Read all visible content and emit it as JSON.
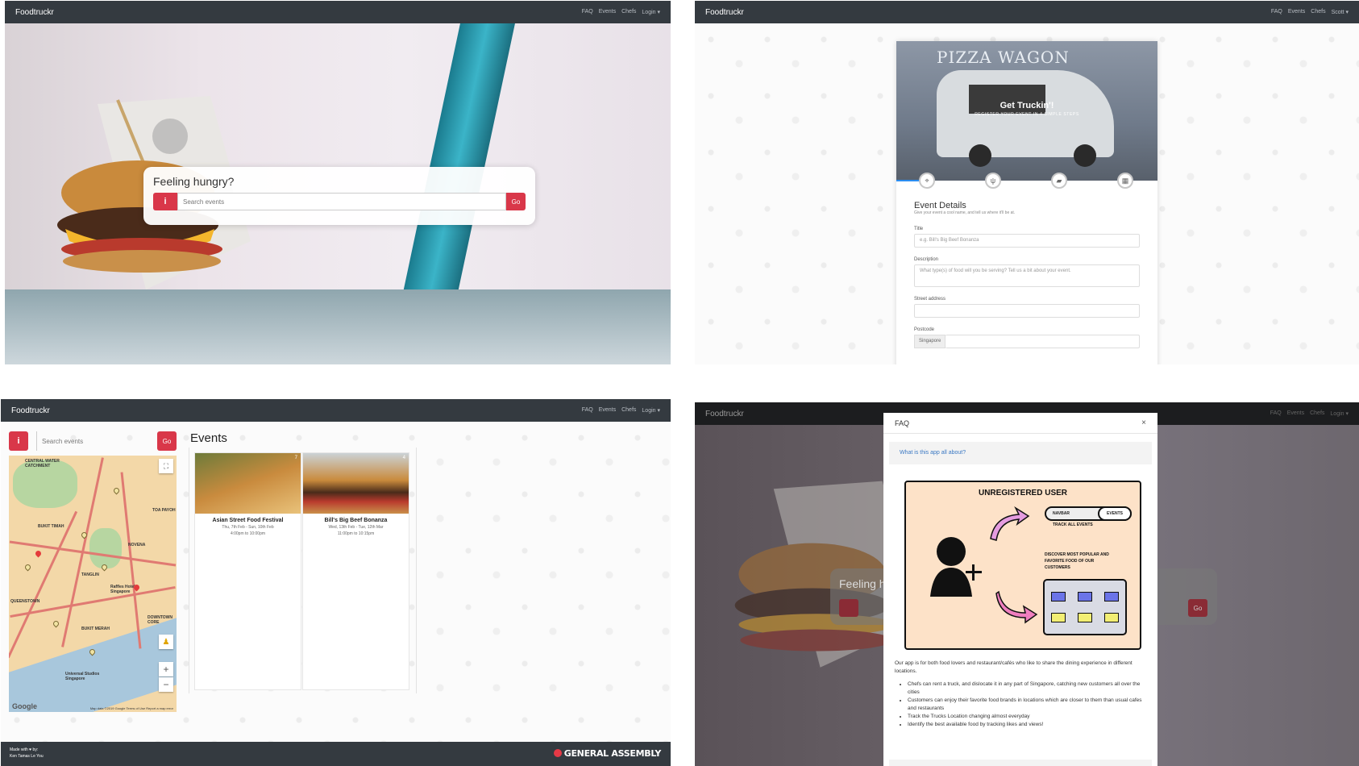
{
  "panel1": {
    "brand": "Foodtruckr",
    "nav": [
      "FAQ",
      "Events",
      "Chefs",
      "Login ▾"
    ],
    "search_title": "Feeling hungry?",
    "info_label": "i",
    "search_placeholder": "Search events",
    "go_label": "Go"
  },
  "panel2": {
    "brand": "Foodtruckr",
    "nav": [
      "FAQ",
      "Events",
      "Chefs",
      "Scott ▾"
    ],
    "hero_sign": "PIZZA WAGON",
    "hero_title": "Get Truckin'!",
    "hero_subtitle": "REGISTER YOUR EVENT IN 4 SIMPLE STEPS",
    "step_icons": [
      "location-icon",
      "cutlery-icon",
      "truck-icon",
      "calendar-icon"
    ],
    "form_heading": "Event Details",
    "form_subheading": "Give your event a cool name, and tell us where it'll be at.",
    "title_label": "Title",
    "title_placeholder": "e.g. Bill's Big Beef Bonanza",
    "description_label": "Description",
    "description_placeholder": "What type(s) of food will you be serving? Tell us a bit about your event.",
    "street_label": "Street address",
    "postcode_label": "Postcode",
    "postcode_prefix": "Singapore"
  },
  "panel3": {
    "brand": "Foodtruckr",
    "nav": [
      "FAQ",
      "Events",
      "Chefs",
      "Login ▾"
    ],
    "info_label": "i",
    "search_placeholder": "Search events",
    "go_label": "Go",
    "events_heading": "Events",
    "map_labels": [
      "CENTRAL WATER CATCHMENT",
      "BUKIT TIMAH",
      "TOA PAYOH",
      "NOVENA",
      "TANGLIN",
      "Raffles Hotel Singapore",
      "QUEENSTOWN",
      "BUKIT MERAH",
      "DOWNTOWN CORE",
      "Universal Studios Singapore"
    ],
    "map_brand": "Google",
    "map_attribution": "Map data ©2019 Google  Terms of Use  Report a map error",
    "events": [
      {
        "name": "Asian Street Food Festival",
        "date": "Thu, 7th Feb - Sun, 10th Feb",
        "time": "4:00pm to 10:00pm",
        "views": "7"
      },
      {
        "name": "Bill's Big Beef Bonanza",
        "date": "Wed, 13th Feb - Tue, 12th Mar",
        "time": "11:00pm to 10:15pm",
        "views": "4"
      }
    ],
    "footer_made": "Made with ♥ by:",
    "footer_names": "Ken  Tamas  Le You",
    "footer_brand": "GENERAL ASSEMBLY"
  },
  "panel4": {
    "brand": "Foodtruckr",
    "nav": [
      "FAQ",
      "Events",
      "Chefs",
      "Login ▾"
    ],
    "dim_search_title": "Feeling h",
    "dim_go_label": "Go",
    "modal_title": "FAQ",
    "close_label": "×",
    "question": "What is this app all about?",
    "illustration_title": "UNREGISTERED USER",
    "pill_navbar": "NAVBAR",
    "pill_events": "EVENTS",
    "note_track": "TRACK ALL EVENTS",
    "note_discover": "DISCOVER MOST POPULAR AND FAVORITE FOOD OF OUR CUSTOMERS",
    "answer_intro": "Our app is for both food lovers and restaurant/cafés who like to share the dining experience in different locations.",
    "answer_points": [
      "Chefs can rent a truck, and dislocate it in any part of Singapore, catching new customers all over the cities",
      "Customers can enjoy their favorite food brands in locations which are closer to them than usual cafes and restaurants",
      "Track the Trucks Location changing almost everyday",
      "Identify the best available food by tracking likes and views!"
    ]
  }
}
